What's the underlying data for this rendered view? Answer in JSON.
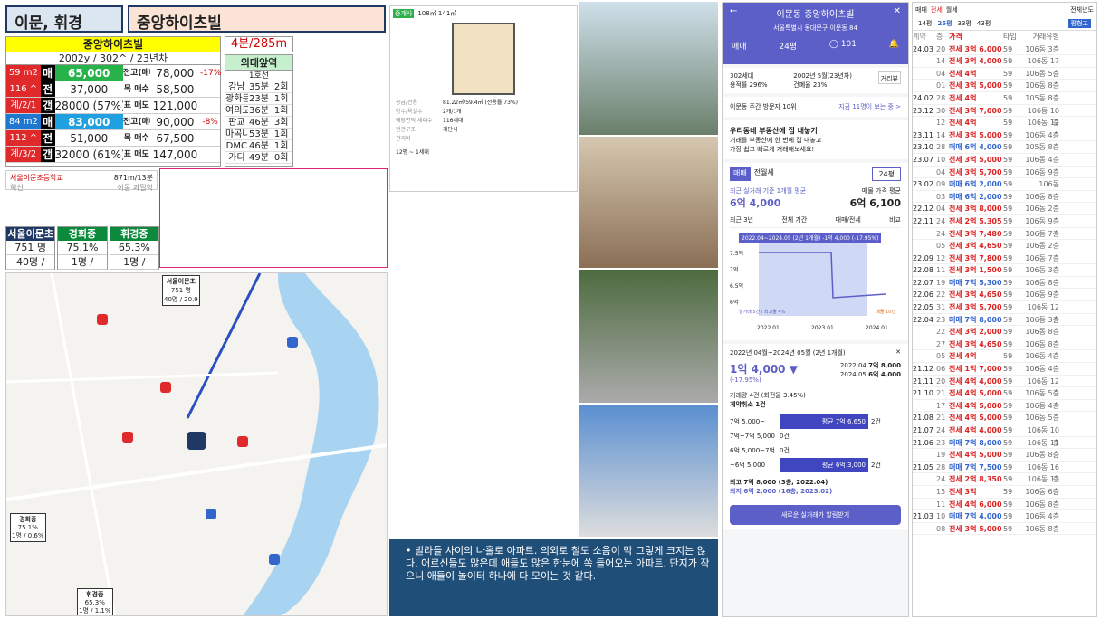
{
  "header": {
    "area": "이문, 휘경",
    "apt": "중앙하이츠빌"
  },
  "summary": {
    "title": "중앙하이츠빌",
    "sub": "2002y / 302^ / 23년차",
    "rows": [
      {
        "tag": "59 m2",
        "tagc": "#e0292b",
        "k": "매",
        "v": "65,000",
        "vbg": "#27b24a",
        "k2": "전고(매매)",
        "v2": "78,000",
        "p": "-17%"
      },
      {
        "tag": "116 ^",
        "tagc": "#e0292b",
        "k": "전",
        "v": "37,000",
        "vbg": "#fff",
        "k2": "목 매수",
        "v2": "58,500",
        "p": ""
      },
      {
        "tag": "계/2/1",
        "tagc": "#e0292b",
        "k": "갭",
        "v": "28000 (57%)",
        "vbg": "#fff",
        "k2": "표 매도",
        "v2": "121,000",
        "p": ""
      },
      {
        "tag": "84 m2",
        "tagc": "#1f77d0",
        "k": "매",
        "v": "83,000",
        "vbg": "#1fa0e0",
        "k2": "전고(매매)",
        "v2": "90,000",
        "p": "-8%"
      },
      {
        "tag": "112 ^",
        "tagc": "#e0292b",
        "k": "전",
        "v": "51,000",
        "vbg": "#fff",
        "k2": "목 매수",
        "v2": "67,500",
        "p": ""
      },
      {
        "tag": "계/3/2",
        "tagc": "#e0292b",
        "k": "갭",
        "v": "32000 (61%)",
        "vbg": "#fff",
        "k2": "표 매도",
        "v2": "147,000",
        "p": ""
      }
    ]
  },
  "floor": "4분/285m",
  "commute": {
    "title": "외대앞역",
    "line": "1호선",
    "rows": [
      [
        "강남",
        "35분",
        "2회"
      ],
      [
        "광화문",
        "23분",
        "1회"
      ],
      [
        "여의도",
        "36분",
        "1회"
      ],
      [
        "판교",
        "46분",
        "3회"
      ],
      [
        "마곡나루",
        "53분",
        "1회"
      ],
      [
        "DMC",
        "46분",
        "1회"
      ],
      [
        "가디",
        "49분",
        "0회"
      ]
    ]
  },
  "school": {
    "name": "서울이문초등학교",
    "dist": "871m/13분",
    "tag1": "혁신",
    "tag2": "이동 과밀학"
  },
  "schools": [
    {
      "name": "서울이문초",
      "c": "#1f3864",
      "a": "751 명",
      "b": "40명 / 20.9"
    },
    {
      "name": "경희중",
      "c": "#0a8a3a",
      "a": "75.1%",
      "b": "1명 / 0.6%"
    },
    {
      "name": "휘경중",
      "c": "#0a8a3a",
      "a": "65.3%",
      "b": "1명 / 1.1%"
    }
  ],
  "map": {
    "l1": "서울이문초",
    "l1a": "751 명",
    "l1b": "40명 / 20.9",
    "l2": "경희중",
    "l2a": "75.1%",
    "l2b": "1명 / 0.6%",
    "l3": "휘경중",
    "l3a": "65.3%",
    "l3b": "1명 / 1.1%"
  },
  "listing": {
    "tag": "중개사",
    "size": "108㎡ 141㎡",
    "f1": "공급/전용",
    "v1": "81.22㎡/59.4㎡ (전용률 73%)",
    "f2": "방수/욕실수",
    "v2": "2개/1개",
    "f3": "해당면적 세대수",
    "v3": "116세대",
    "f4": "현관구조",
    "v4": "계단식",
    "f5": "관리비",
    "v5": "",
    "foot": "12평 ~ 1세대"
  },
  "note": "빌라들 사이의 나홀로 아파트. 의외로 철도 소음이 막 그렇게 크지는 않다. 어르신들도 많은데 애들도 많은 한눈에 쏙 들어오는 아파트. 단지가 작으니 애들이 놀이터 하나에 다 모이는 것 같다.",
  "app": {
    "title": "이문동 중앙하이츠빌",
    "addr": "서울특별시 동대문구 이문동 84",
    "tab1": "매매",
    "tab2": "24평",
    "cnt": "101",
    "i1": "302세대",
    "i2": "2002년 5월(23년차)",
    "i3": "용적률 296%",
    "i4": "건폐율 23%",
    "btn": "거리뷰",
    "visit": "이문동 주간 방문자 10위",
    "visitlink": "지금 11명이 보는 중 >",
    "ad1": "우리동네 부동산에 집 내놓기",
    "ad2": "거래를 부동산에 한 번에 집 내놓고",
    "ad3": "가장 쉽고 빠르게 거래해보세요!",
    "t1": "매매",
    "t2": "전월세",
    "sel": "24평",
    "lbl1": "최근 실거래 기준 1개월 평균",
    "v1": "6억 4,000",
    "lbl2": "매물 가격 평균",
    "v2": "6억 6,100",
    "ct1": "최근 3년",
    "ct2": "전체 기간",
    "ct3": "매매/전세",
    "ct4": "비교",
    "chip": "2022.04~2024.05 (2년 1개월) -1억 4,000 (-17.95%)",
    "y1": "7.5억",
    "y2": "7억",
    "y3": "6.5억",
    "y4": "6억",
    "x1": "2022.01",
    "x2": "2023.01",
    "x3": "2024.01",
    "legend1": "실거래 5건 / 최고율 4%",
    "legend2": "매물 10건",
    "period": "2022년 04월~2024년 05월 (2년 1개월)",
    "diff": "1억 4,000 ▼",
    "diffp": "(-17.95%)",
    "d1": "2022.04",
    "d1v": "7억 8,000",
    "d2": "2024.05",
    "d2v": "6억 4,000",
    "vol": "거래량 4건 (회전율 3.45%)",
    "cancel": "계약취소 1건",
    "b1": "7억 5,000~",
    "b1v": "평균 7억 6,650",
    "b1c": "2건",
    "b2": "7억~7억 5,000",
    "b2c": "0건",
    "b3": "6억 5,000~7억",
    "b3c": "0건",
    "b4": "~6억 5,000",
    "b4v": "평균 6억 3,000",
    "b4c": "2건",
    "hi": "최고 7억 8,000 (3층, 2022.04)",
    "lo": "최저 6억 2,000 (16층, 2023.02)",
    "cta": "새로운 실거래가 알림받기"
  },
  "tl": {
    "tabs": [
      "매매",
      "전세",
      "월세"
    ],
    "year": "전체년도",
    "sizes": [
      "14평",
      "25평",
      "33평",
      "43평"
    ],
    "btn": "평형고",
    "head": [
      "계약",
      "층",
      "가격",
      "타입",
      "거래유형"
    ],
    "rows": [
      [
        "24.03",
        "20",
        "전세 3억 6,000",
        "59",
        "106동 3층"
      ],
      [
        "",
        "14",
        "전세 3억 4,000",
        "59",
        "106동 17층"
      ],
      [
        "",
        "04",
        "전세 4억",
        "59",
        "106동 5층"
      ],
      [
        "",
        "01",
        "전세 3억 5,000",
        "59",
        "106동 8층"
      ],
      [
        "24.02",
        "28",
        "전세 4억",
        "59",
        "105동 8층"
      ],
      [
        "23.12",
        "30",
        "전세 3억 7,000",
        "59",
        "106동 10층"
      ],
      [
        "",
        "12",
        "전세 4억",
        "59",
        "106동 12층"
      ],
      [
        "23.11",
        "14",
        "전세 3억 5,000",
        "59",
        "106동 4층"
      ],
      [
        "23.10",
        "28",
        "매매 6억 4,000",
        "59",
        "105동 8층"
      ],
      [
        "23.07",
        "10",
        "전세 3억 5,000",
        "59",
        "106동 4층"
      ],
      [
        "",
        "04",
        "전세 3억 5,700",
        "59",
        "106동 9층"
      ],
      [
        "23.02",
        "09",
        "매매 6억 2,000",
        "59",
        "106동"
      ],
      [
        "",
        "03",
        "매매 6억 2,000",
        "59",
        "106동 8층"
      ],
      [
        "22.12",
        "04",
        "전세 3억 8,000",
        "59",
        "106동 2층"
      ],
      [
        "22.11",
        "24",
        "전세 2억 5,305",
        "59",
        "106동 9층"
      ],
      [
        "",
        "24",
        "전세 3억 7,480",
        "59",
        "106동 7층"
      ],
      [
        "",
        "05",
        "전세 3억 4,650",
        "59",
        "106동 2층"
      ],
      [
        "22.09",
        "12",
        "전세 3억 7,800",
        "59",
        "106동 7층"
      ],
      [
        "22.08",
        "11",
        "전세 3억 1,500",
        "59",
        "106동 3층"
      ],
      [
        "22.07",
        "19",
        "매매 7억 5,300",
        "59",
        "106동 8층"
      ],
      [
        "22.06",
        "22",
        "전세 3억 4,650",
        "59",
        "106동 9층"
      ],
      [
        "22.05",
        "31",
        "전세 3억 5,700",
        "59",
        "106동 12층"
      ],
      [
        "22.04",
        "23",
        "매매 7억 8,000",
        "59",
        "106동 3층"
      ],
      [
        "",
        "22",
        "전세 3억 2,000",
        "59",
        "106동 8층"
      ],
      [
        "",
        "27",
        "전세 3억 4,650",
        "59",
        "106동 8층"
      ],
      [
        "",
        "05",
        "전세 4억",
        "59",
        "106동 4층"
      ],
      [
        "21.12",
        "06",
        "전세 1억 7,000",
        "59",
        "106동 4층"
      ],
      [
        "21.11",
        "20",
        "전세 4억 4,000",
        "59",
        "106동 12층"
      ],
      [
        "21.10",
        "21",
        "전세 4억 5,000",
        "59",
        "106동 5층"
      ],
      [
        "",
        "17",
        "전세 4억 5,000",
        "59",
        "106동 4층"
      ],
      [
        "21.08",
        "21",
        "전세 4억 5,000",
        "59",
        "106동 5층"
      ],
      [
        "21.07",
        "24",
        "전세 4억 4,000",
        "59",
        "106동 10층"
      ],
      [
        "21.06",
        "23",
        "매매 7억 8,000",
        "59",
        "106동 11층"
      ],
      [
        "",
        "19",
        "전세 4억 5,000",
        "59",
        "106동 8층"
      ],
      [
        "21.05",
        "28",
        "매매 7억 7,500",
        "59",
        "106동 16층"
      ],
      [
        "",
        "24",
        "전세 2억 8,350",
        "59",
        "106동 13층"
      ],
      [
        "",
        "15",
        "전세 3억",
        "59",
        "106동 6층"
      ],
      [
        "",
        "11",
        "전세 4억 6,000",
        "59",
        "106동 8층"
      ],
      [
        "21.03",
        "10",
        "매매 7억 4,000",
        "59",
        "106동 4층"
      ],
      [
        "",
        "08",
        "전세 3억 5,000",
        "59",
        "106동 8층"
      ]
    ]
  }
}
